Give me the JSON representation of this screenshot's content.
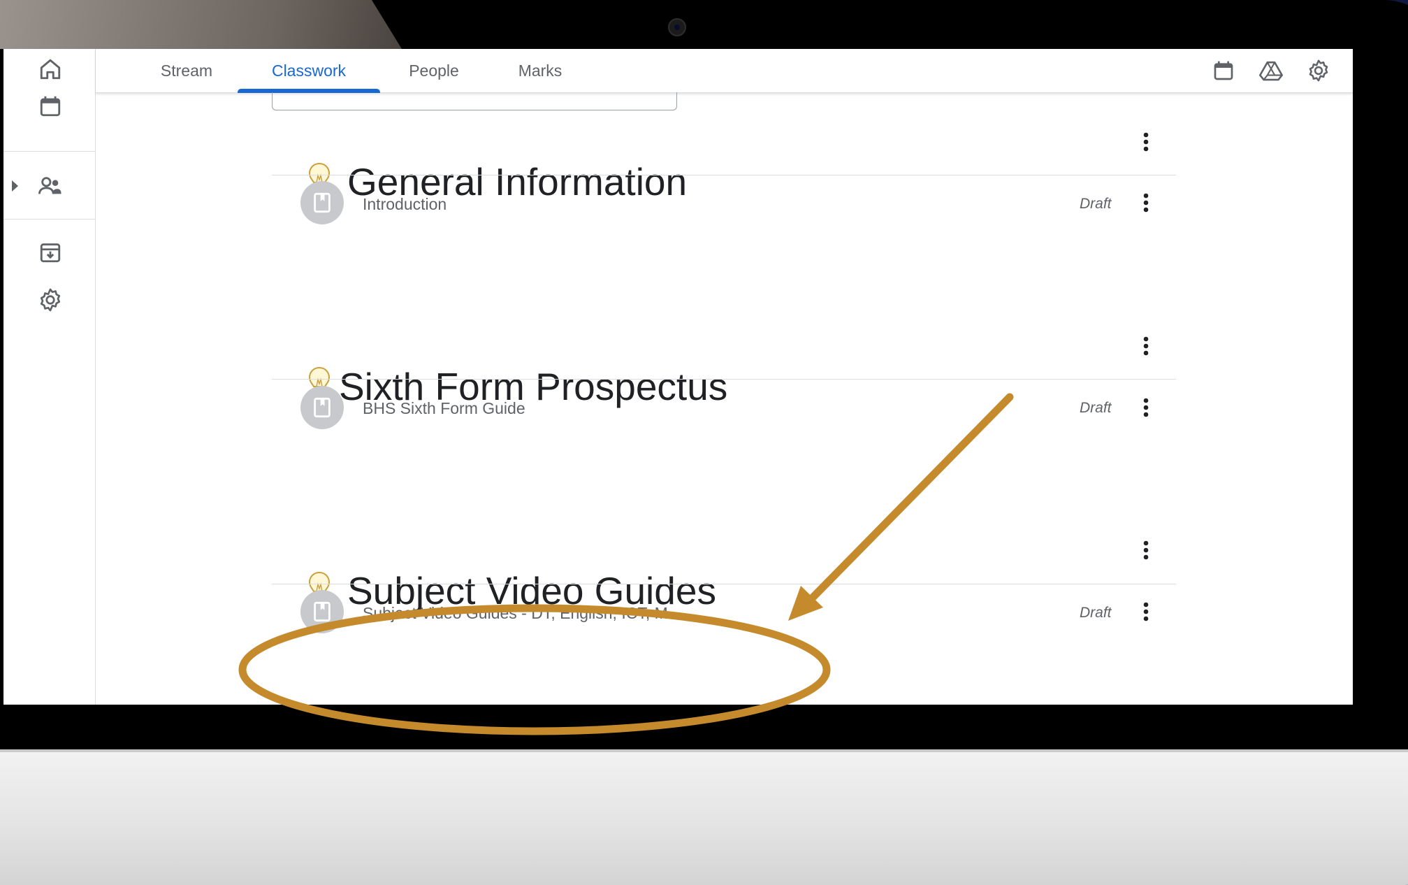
{
  "tabs": [
    {
      "label": "Stream"
    },
    {
      "label": "Classwork"
    },
    {
      "label": "People"
    },
    {
      "label": "Marks"
    }
  ],
  "active_tab": "Classwork",
  "topics": [
    {
      "title": "General Information",
      "item": {
        "title": "Introduction",
        "status": "Draft"
      }
    },
    {
      "title": "Sixth Form Prospectus",
      "item": {
        "title": "BHS Sixth Form Guide",
        "status": "Draft"
      }
    },
    {
      "title": "Subject Video Guides",
      "item": {
        "title": "Subject Video Guides - DT, English, ICT, M...",
        "status": "Draft"
      }
    }
  ],
  "icons": {
    "rail": [
      "home-icon",
      "calendar-icon",
      "people-icon",
      "archive-icon",
      "settings-icon"
    ],
    "topbar": [
      "calendar-icon",
      "drive-icon",
      "settings-icon"
    ],
    "topic": "lightbulb-icon",
    "item": "material-icon",
    "menu": "more-vert-icon"
  },
  "colors": {
    "accent": "#1967d2",
    "annotation": "#c48a2c",
    "text_primary": "#202124",
    "text_secondary": "#5f6368"
  }
}
